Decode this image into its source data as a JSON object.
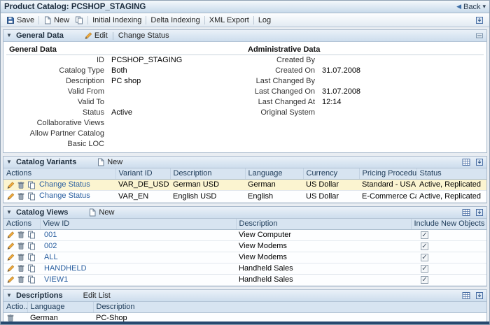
{
  "titlebar": {
    "title": "Product Catalog: PCSHOP_STAGING",
    "back_label": "Back"
  },
  "icons": {
    "section_collapse": "▼",
    "back_arrow": "◀",
    "menu_caret": "▾",
    "check": "✓"
  },
  "toolbar": {
    "save": "Save",
    "new": "New",
    "initial_indexing": "Initial Indexing",
    "delta_indexing": "Delta Indexing",
    "xml_export": "XML Export",
    "log": "Log"
  },
  "general": {
    "title": "General Data",
    "edit": "Edit",
    "change_status": "Change Status",
    "left_heading": "General Data",
    "right_heading": "Administrative Data",
    "left_fields": [
      {
        "label": "ID",
        "value": "PCSHOP_STAGING"
      },
      {
        "label": "Catalog Type",
        "value": "Both"
      },
      {
        "label": "Description",
        "value": "PC shop"
      },
      {
        "label": "Valid From",
        "value": ""
      },
      {
        "label": "Valid To",
        "value": ""
      },
      {
        "label": "Status",
        "value": "Active"
      },
      {
        "label": "Collaborative Views",
        "value": ""
      },
      {
        "label": "Allow Partner Catalog",
        "value": ""
      },
      {
        "label": "Basic LOC",
        "value": ""
      }
    ],
    "right_fields": [
      {
        "label": "Created By",
        "value": ""
      },
      {
        "label": "Created On",
        "value": "31.07.2008"
      },
      {
        "label": "Last Changed By",
        "value": ""
      },
      {
        "label": "Last Changed On",
        "value": "31.07.2008"
      },
      {
        "label": "Last Changed At",
        "value": "12:14"
      },
      {
        "label": "Original System",
        "value": ""
      }
    ]
  },
  "variants": {
    "title": "Catalog Variants",
    "new": "New",
    "columns": [
      "Actions",
      "Variant ID",
      "Description",
      "Language",
      "Currency",
      "Pricing Procedure",
      "Status"
    ],
    "rows": [
      {
        "action": "Change Status",
        "variant_id": "VAR_DE_USD",
        "description": "German USD",
        "language": "German",
        "currency": "US Dollar",
        "pricing": "Standard - USA /...",
        "status": "Active, Replicated"
      },
      {
        "action": "Change Status",
        "variant_id": "VAR_EN",
        "description": "English USD",
        "language": "English",
        "currency": "US Dollar",
        "pricing": "E-Commerce Cat...",
        "status": "Active, Replicated"
      }
    ]
  },
  "views": {
    "title": "Catalog Views",
    "new": "New",
    "columns": [
      "Actions",
      "View ID",
      "Description",
      "Include New Objects"
    ],
    "rows": [
      {
        "view_id": "001",
        "description": "View Computer",
        "include_new": true
      },
      {
        "view_id": "002",
        "description": "View Modems",
        "include_new": true
      },
      {
        "view_id": "ALL",
        "description": "View Modems",
        "include_new": true
      },
      {
        "view_id": "HANDHELD",
        "description": "Handheld Sales",
        "include_new": true
      },
      {
        "view_id": "VIEW1",
        "description": "Handheld Sales",
        "include_new": true
      }
    ]
  },
  "descriptions": {
    "title": "Descriptions",
    "edit_list": "Edit List",
    "columns": [
      "Actio...",
      "Language",
      "Description"
    ],
    "rows": [
      {
        "language": "German",
        "description": "PC-Shop"
      }
    ]
  }
}
